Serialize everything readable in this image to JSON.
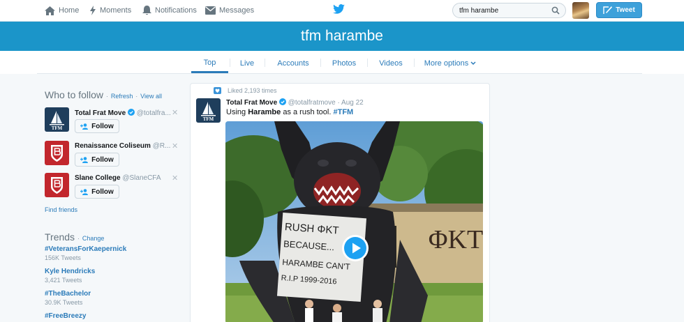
{
  "nav": {
    "home": "Home",
    "moments": "Moments",
    "notifications": "Notifications",
    "messages": "Messages"
  },
  "search": {
    "value": "tfm harambe"
  },
  "tweet_button": "Tweet",
  "banner_title": "tfm harambe",
  "tabs": [
    "Top",
    "Live",
    "Accounts",
    "Photos",
    "Videos",
    "More options"
  ],
  "who_to_follow": {
    "title": "Who to follow",
    "refresh": "Refresh",
    "view_all": "View all",
    "suggestions": [
      {
        "name": "Total Frat Move",
        "handle": "@totalfra...",
        "follow": "Follow",
        "logo": "TFM"
      },
      {
        "name": "Renaissance Coliseum",
        "handle": "@R...",
        "follow": "Follow"
      },
      {
        "name": "Slane College",
        "handle": "@SlaneCFA",
        "follow": "Follow"
      }
    ],
    "find_friends": "Find friends"
  },
  "trends": {
    "title": "Trends",
    "change": "Change",
    "items": [
      {
        "name": "#VeteransForKaepernick",
        "count": "156K Tweets"
      },
      {
        "name": "Kyle Hendricks",
        "count": "3,421 Tweets"
      },
      {
        "name": "#TheBachelor",
        "count": "30.9K Tweets"
      },
      {
        "name": "#FreeBreezy",
        "count": ""
      }
    ]
  },
  "tweet": {
    "liked": "Liked 2,193 times",
    "author": "Total Frat Move",
    "handle": "@totalfratmove",
    "date": "Aug 22",
    "text_before": "Using ",
    "text_bold": "Harambe",
    "text_after": " as a rush tool. ",
    "hashtag": "#TFM",
    "logo": "TFM",
    "sign_line1": "RUSH ΦKT",
    "sign_line2": "BECAUSE...",
    "sign_line3": "HARAMBE CAN'T",
    "sign_line4": "R.I.P 1999-2016",
    "house_letters": "ΦKT"
  },
  "colors": {
    "accent": "#1b95c9",
    "link": "#2b7bb9",
    "tweet_button": "#3ea1da"
  }
}
